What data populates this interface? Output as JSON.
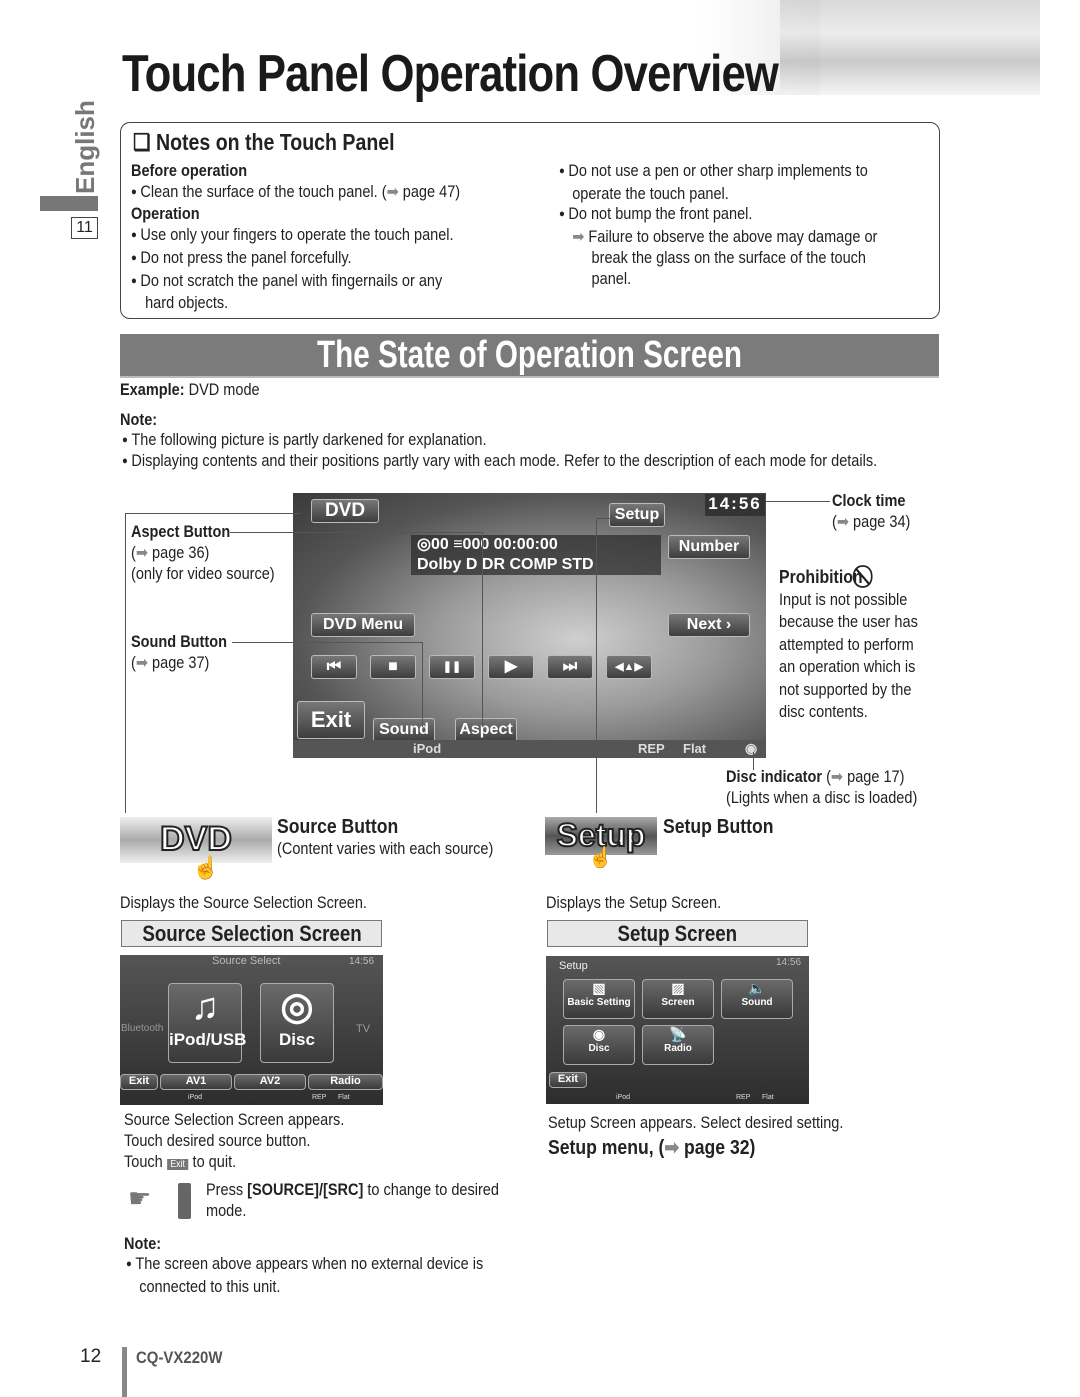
{
  "header": {
    "title": "Touch Panel Operation Overview",
    "language_tab": "English",
    "chapter_number": "11"
  },
  "notes": {
    "heading": "Notes on the Touch Panel",
    "before_operation": {
      "title": "Before operation",
      "items": [
        "Clean the surface of the touch panel. (",
        "page 47)"
      ]
    },
    "operation": {
      "title": "Operation",
      "items": [
        "Use only your fingers to operate the touch panel.",
        "Do not press the panel forcefully.",
        "Do not scratch the panel with fingernails or any",
        "hard objects."
      ]
    },
    "right_items": [
      "Do not use a pen or other sharp implements to",
      "operate the touch panel.",
      "Do not bump the front panel.",
      "Failure to observe the above may damage or",
      "break the glass on the surface of the touch",
      "panel."
    ]
  },
  "section": {
    "title": "The State of Operation Screen",
    "example_label": "Example:",
    "example_value": "DVD mode",
    "note_label": "Note:",
    "notes": [
      "The following picture is partly darkened for explanation.",
      "Displaying contents and their positions partly vary with each mode. Refer to the description of each mode for details."
    ]
  },
  "dvd_screen": {
    "source_btn": "DVD",
    "setup_btn": "Setup",
    "clock": "14:56",
    "info_line1": "◎00  ≡000  00:00:00",
    "info_line2": "Dolby D  DR COMP STD",
    "number_btn": "Number",
    "dvd_menu_btn": "DVD Menu",
    "next_btn": "Next ›",
    "transport": [
      "⏮",
      "■",
      "❚❚",
      "▶",
      "⏭",
      "◀▲▶"
    ],
    "exit_btn": "Exit",
    "sound_btn": "Sound",
    "aspect_btn": "Aspect",
    "status_left": "iPod",
    "status_rep": "REP",
    "status_flat": "Flat"
  },
  "callouts": {
    "aspect": {
      "title": "Aspect Button",
      "ref": "page 36)",
      "extra": "(only for video source)"
    },
    "sound": {
      "title": "Sound Button",
      "ref": "page 37)"
    },
    "clock": {
      "title": "Clock time",
      "ref": "page 34)"
    },
    "prohibition": {
      "title": "Prohibition",
      "lines": [
        "Input is not possible",
        "because the user has",
        "attempted to perform",
        "an operation which is",
        "not supported by the",
        "disc contents."
      ]
    },
    "disc_indicator": {
      "title": "Disc indicator",
      "ref": "page 17)",
      "extra": "(Lights when a disc is loaded)"
    }
  },
  "source_section": {
    "button_img_label": "DVD",
    "title": "Source Button",
    "subtitle": "(Content varies with each source)",
    "displays": "Displays the Source Selection Screen.",
    "box_title": "Source Selection Screen",
    "screen": {
      "header": "Source Select",
      "clock": "14:56",
      "side_left": "Bluetooth",
      "side_right": "TV",
      "tiles": [
        "iPod/USB",
        "Disc"
      ],
      "bottom": [
        "Exit",
        "AV1",
        "AV2",
        "Radio"
      ],
      "status": [
        "iPod",
        "REP",
        "Flat"
      ]
    },
    "after": [
      "Source Selection Screen appears.",
      "Touch desired source button."
    ],
    "touch_prefix": "Touch",
    "touch_btn": "Exit",
    "touch_suffix": "to quit.",
    "press_prefix": "Press",
    "press_key": "[SOURCE]/[SRC]",
    "press_suffix": "to change to desired",
    "press_line2": "mode.",
    "note_label": "Note:",
    "note_lines": [
      "The screen above appears when no external device is",
      "connected to this unit."
    ]
  },
  "setup_section": {
    "button_img_label": "Setup",
    "title": "Setup Button",
    "displays": "Displays the Setup Screen.",
    "box_title": "Setup Screen",
    "screen": {
      "header": "Setup",
      "clock": "14:56",
      "tiles": [
        "Basic Setting",
        "Screen",
        "Sound",
        "Disc",
        "Radio"
      ],
      "exit": "Exit",
      "status": [
        "iPod",
        "REP",
        "Flat"
      ]
    },
    "after": "Setup Screen appears. Select desired setting.",
    "menu_ref": "Setup menu, (",
    "menu_page": "page 32)"
  },
  "footer": {
    "page_number": "12",
    "model": "CQ-VX220W"
  }
}
